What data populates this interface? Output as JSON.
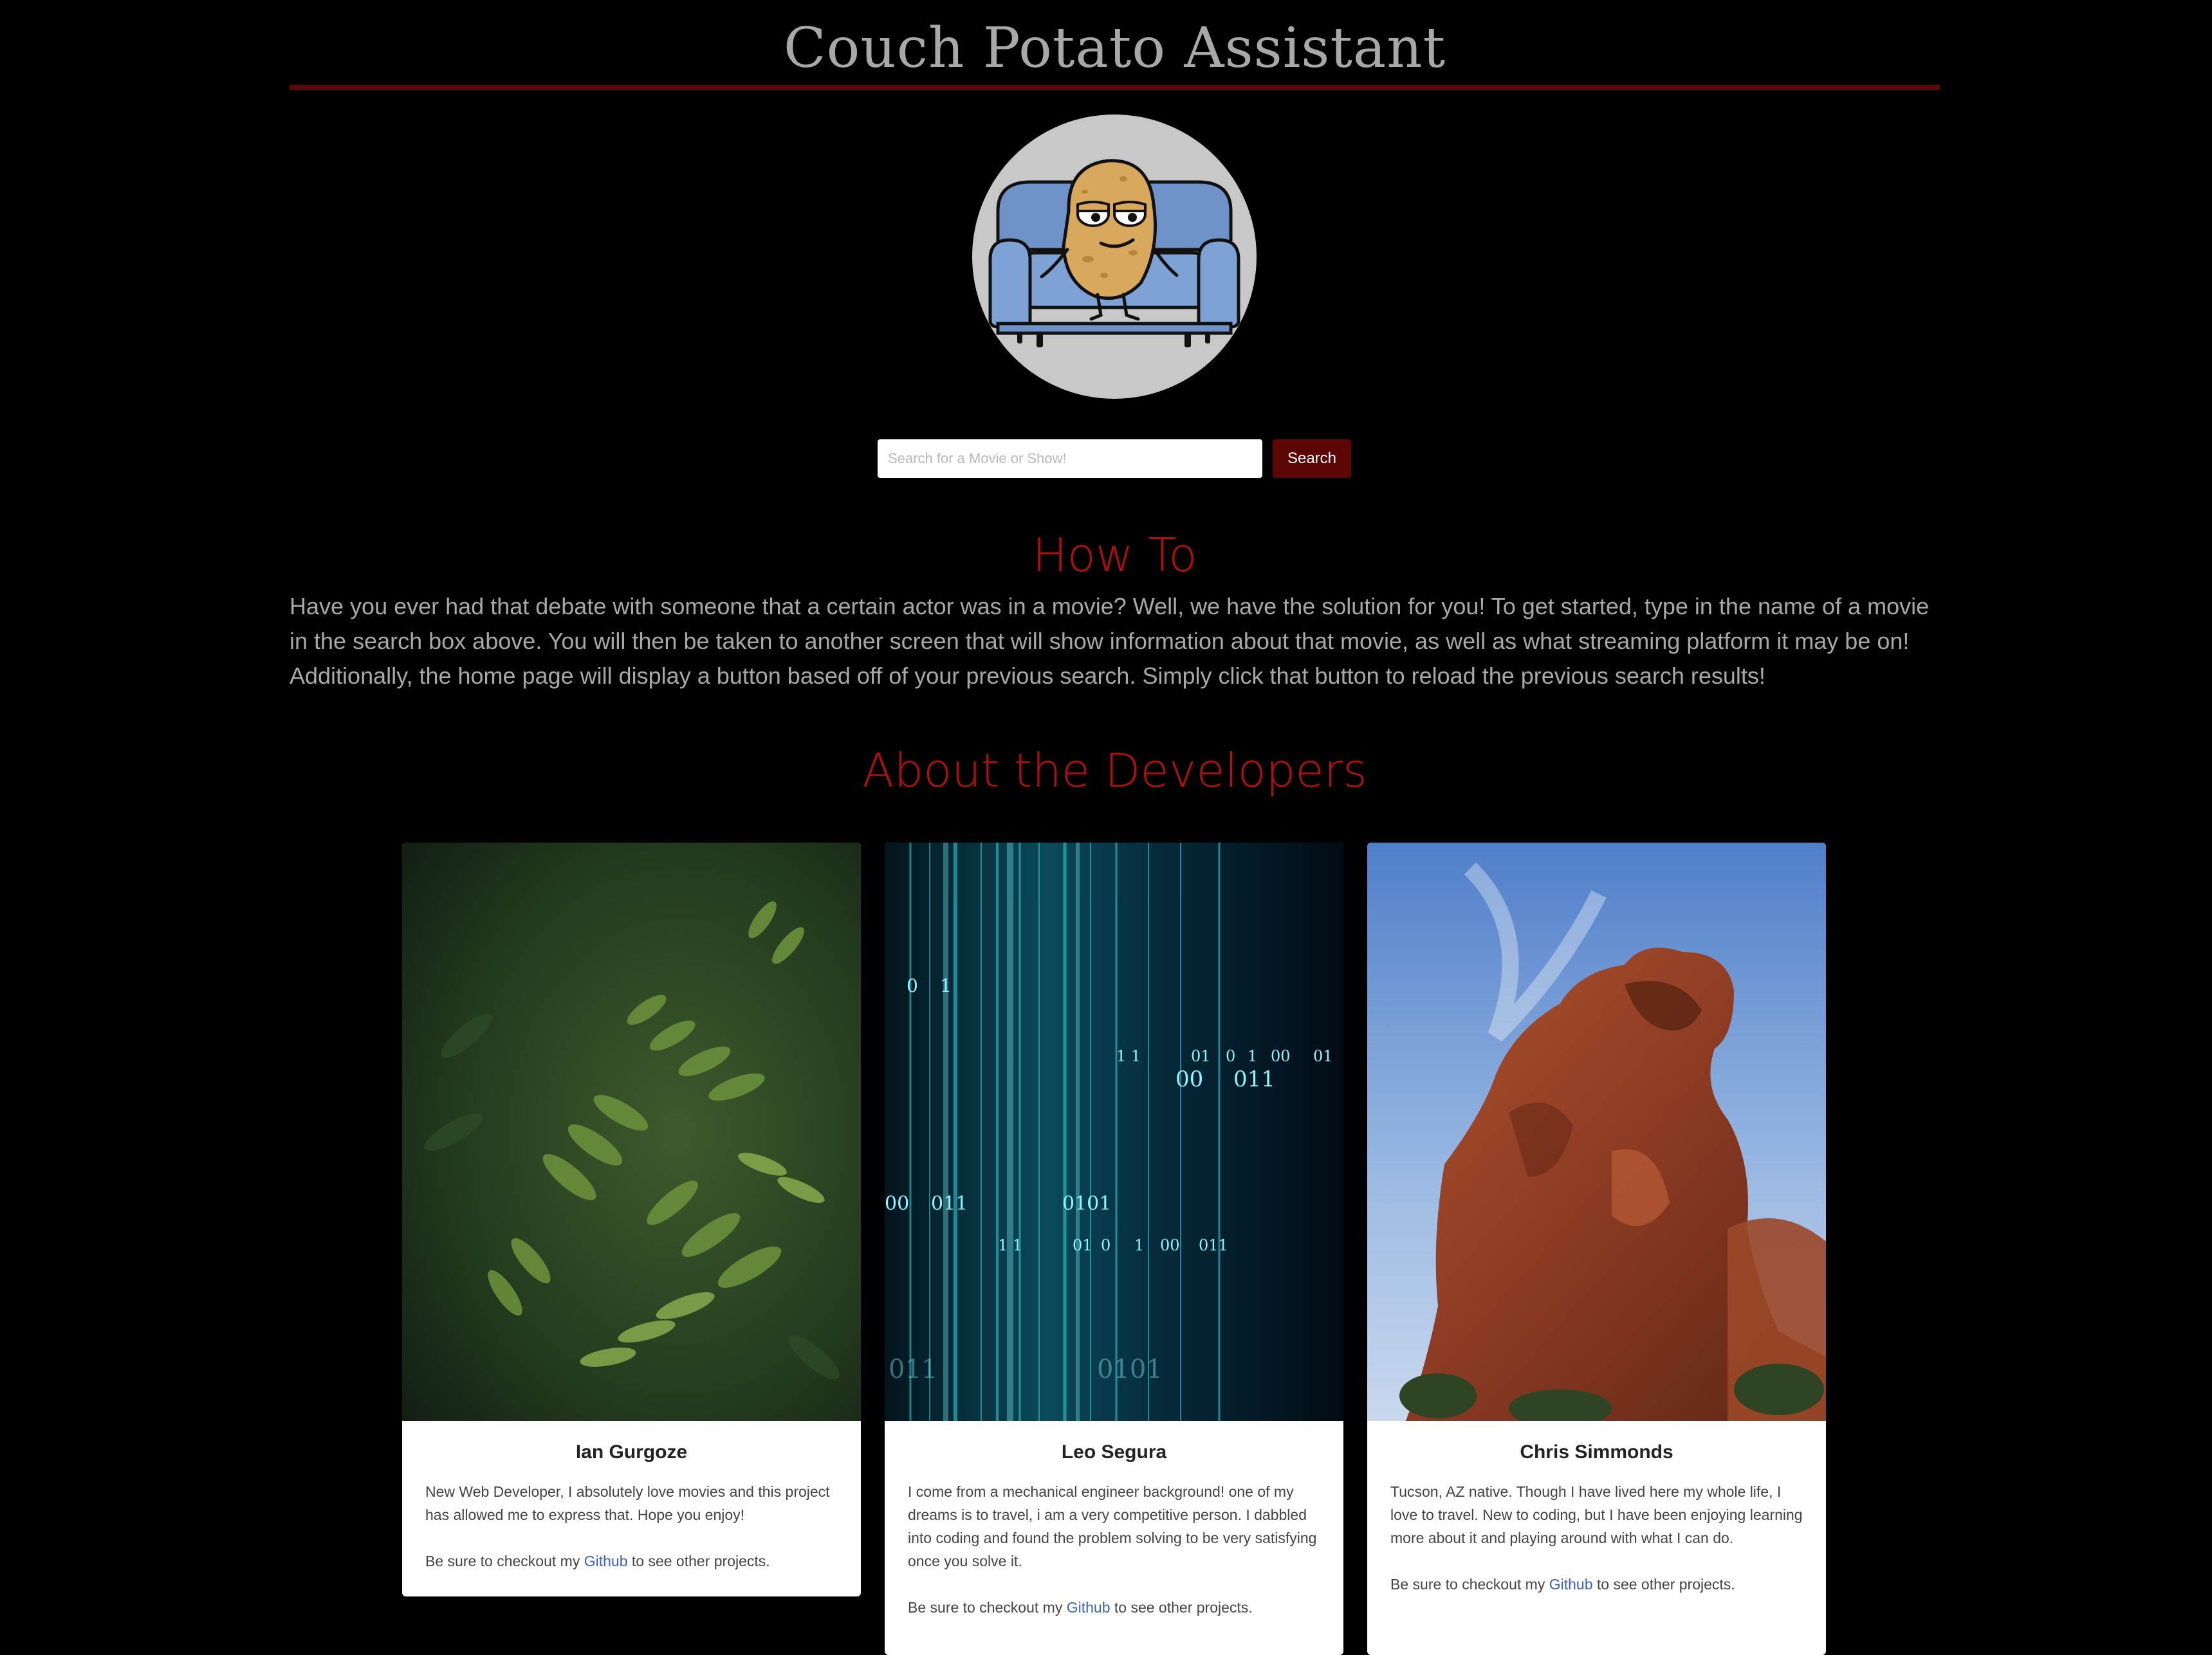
{
  "header": {
    "title": "Couch Potato Assistant"
  },
  "search": {
    "placeholder": "Search for a Movie or Show!",
    "button_label": "Search"
  },
  "howto": {
    "heading": "How To",
    "text": "Have you ever had that debate with someone that a certain actor was in a movie? Well, we have the solution for you! To get started, type in the name of a movie in the search box above. You will then be taken to another screen that will show information about that movie, as well as what streaming platform it may be on! Additionally, the home page will display a button based off of your previous search. Simply click that button to reload the previous search results!"
  },
  "developers": {
    "heading": "About the Developers",
    "cards": [
      {
        "name": "Ian Gurgoze",
        "bio": "New Web Developer, I absolutely love movies and this project has allowed me to express that. Hope you enjoy!",
        "foot_before": "Be sure to checkout my ",
        "link": "Github",
        "foot_after": " to see other projects."
      },
      {
        "name": "Leo Segura",
        "bio": "I come from a mechanical engineer background! one of my dreams is to travel, i am a very competitive person. I dabbled into coding and found the problem solving to be very satisfying once you solve it.",
        "foot_before": "Be sure to checkout my ",
        "link": "Github",
        "foot_after": " to see other projects."
      },
      {
        "name": "Chris Simmonds",
        "bio": "Tucson, AZ native. Though I have lived here my whole life, I love to travel. New to coding, but I have been enjoying learning more about it and playing around with what I can do.",
        "foot_before": "Be sure to checkout my ",
        "link": "Github",
        "foot_after": " to see other projects."
      }
    ]
  },
  "binary_digits": [
    "0",
    "1",
    "1 1",
    "01",
    "0",
    "1",
    "00",
    "01",
    "00",
    "011",
    "00",
    "011",
    "0101",
    "1 1",
    "01",
    "0",
    "1",
    "00",
    "011",
    "011",
    "0101"
  ],
  "colors": {
    "background": "#000000",
    "accent_red": "#b50e0e",
    "rule": "#5a0a0a",
    "button": "#5c0606",
    "link": "#3a5fcd"
  }
}
